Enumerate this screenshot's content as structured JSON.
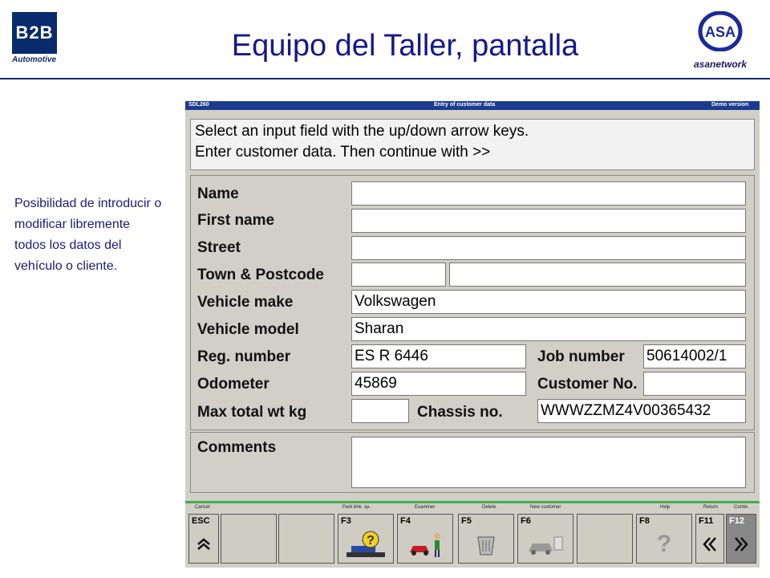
{
  "slide": {
    "title": "Equipo del Taller, pantalla",
    "note": "Posibilidad de introducir o modificar libremente todos los datos del vehículo o cliente.",
    "logo_left": {
      "main": "B2B",
      "sub": "Automotive"
    },
    "logo_right": {
      "main": "ASA",
      "sub": "asanetwork"
    }
  },
  "app": {
    "code": "SDL260",
    "window_title": "Entry of customer data",
    "version": "Demo version",
    "message": {
      "line1": "Select an input field with the up/down arrow keys.",
      "line2": "Enter customer data. Then continue with >>"
    },
    "labels": {
      "name": "Name",
      "first_name": "First name",
      "street": "Street",
      "town_postcode": "Town & Postcode",
      "vehicle_make": "Vehicle make",
      "vehicle_model": "Vehicle model",
      "reg_number": "Reg. number",
      "job_number": "Job number",
      "odometer": "Odometer",
      "customer_no": "Customer No.",
      "max_total_wt": "Max total wt  kg",
      "chassis_no": "Chassis no.",
      "comments": "Comments"
    },
    "values": {
      "name": "",
      "first_name": "",
      "street": "",
      "town": "",
      "postcode": "",
      "vehicle_make": "Volkswagen",
      "vehicle_model": "Sharan",
      "reg_number": "ES R 6446",
      "job_number": "50614002/1",
      "odometer": "45869",
      "customer_no": "",
      "max_total_wt": "",
      "chassis_no": "WWWZZMZ4V00365432",
      "comments": ""
    },
    "toolbar": {
      "labels": {
        "cancel": "Cancel",
        "park": "Park bhk. sp.",
        "examiner": "Examiner",
        "delete": "Delete",
        "new_customer": "New customer",
        "help": "Help",
        "return": "Return",
        "continue": "Contin."
      },
      "keys": {
        "esc": "ESC",
        "f3": "F3",
        "f4": "F4",
        "f5": "F5",
        "f6": "F6",
        "f8": "F8",
        "f11": "F11",
        "f12": "F12"
      },
      "icons": {
        "esc": "chevron-up-icon",
        "f3": "park-vehicle-icon",
        "f4": "examiner-icon",
        "f5": "trash-icon",
        "f6": "new-customer-icon",
        "f8": "help-icon",
        "f11": "double-left-icon",
        "f12": "double-right-icon"
      }
    },
    "colors": {
      "titlebar": "#1a3b8f",
      "toolbar_border": "#3db04a",
      "title": "#16188a"
    }
  }
}
